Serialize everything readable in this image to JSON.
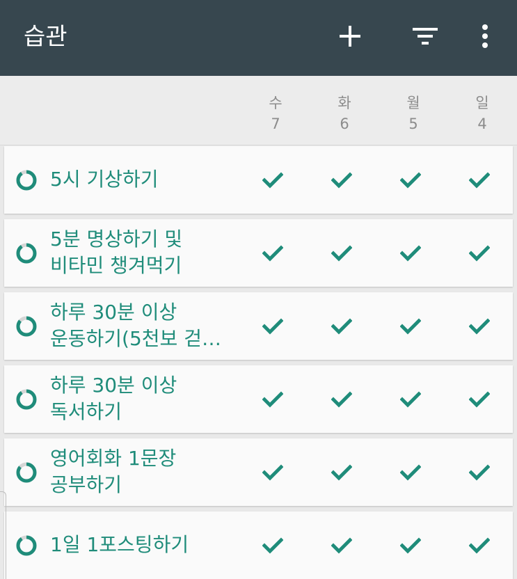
{
  "app": {
    "title": "습관"
  },
  "toolbar": {
    "icons": [
      "plus-icon",
      "filter-icon",
      "more-vertical-icon"
    ]
  },
  "colors": {
    "appbar": "#37474f",
    "accent": "#1f8c7a",
    "ring_track": "#d6d6d6",
    "header_bg": "#ececec",
    "row_bg": "#fafafa",
    "day_text": "#8c8c8c"
  },
  "days": [
    {
      "weekday": "수",
      "date": "7"
    },
    {
      "weekday": "화",
      "date": "6"
    },
    {
      "weekday": "월",
      "date": "5"
    },
    {
      "weekday": "일",
      "date": "4"
    }
  ],
  "habits": [
    {
      "name": "5시 기상하기",
      "progress": 0.9,
      "checks": [
        true,
        true,
        true,
        true
      ]
    },
    {
      "name": "5분 명상하기 및\n비타민 챙겨먹기",
      "progress": 0.9,
      "checks": [
        true,
        true,
        true,
        true
      ]
    },
    {
      "name": "하루 30분 이상\n운동하기(5천보 걷…",
      "progress": 0.86,
      "checks": [
        true,
        true,
        true,
        true
      ]
    },
    {
      "name": "하루 30분 이상\n독서하기",
      "progress": 0.9,
      "checks": [
        true,
        true,
        true,
        true
      ]
    },
    {
      "name": "영어회화 1문장\n공부하기",
      "progress": 0.86,
      "checks": [
        true,
        true,
        true,
        true
      ]
    },
    {
      "name": "1일 1포스팅하기",
      "progress": 0.9,
      "checks": [
        true,
        true,
        true,
        true
      ]
    }
  ]
}
